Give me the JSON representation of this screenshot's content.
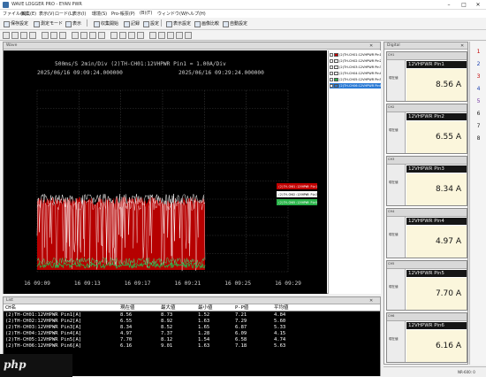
{
  "window": {
    "title": "WAVE LOGGER PRO - EYAN PWR"
  },
  "menu": [
    "ファイル(F)",
    "編集(E)",
    "表示(V)",
    "ロード(L)",
    "表示(I)",
    "環境(S)",
    "Pro-帳票(P)",
    "(B)(T)",
    "ウィンドウ(W)",
    "ヘルプ(H)"
  ],
  "toolbar": {
    "left": [
      "保存設定",
      "測定モード",
      "表示"
    ],
    "mid": [
      "収集開始",
      "記録",
      "設定"
    ],
    "right": [
      "表示設定",
      "画像比較",
      "自動設定"
    ]
  },
  "wave_panel": {
    "title": "Wave"
  },
  "chart": {
    "header_line": "500ms/S    2min/Div    (2)TH-CH01:12VHPWR Pin1 = 1.00A/Div",
    "start_time": "2025/06/16 09:09:24.000000",
    "end_time": "2025/06/16 09:29:24.000000",
    "x_ticks": [
      "16 09:09",
      "16 09:13",
      "16 09:17",
      "16 09:21",
      "16 09:25",
      "16 09:29"
    ],
    "colors": {
      "bg": "#000000",
      "grid": "#3a3a3a",
      "text": "#cfcfcf",
      "red": "#c00000",
      "green": "#2ab34a",
      "white": "#ffffff"
    },
    "series": [
      {
        "name": "(2)TH-CH01:12VHPWR Pin1",
        "color": "#c00000"
      },
      {
        "name": "(2)TH-CH02:12VHPWR Pin2",
        "color": "#f5f5f5"
      },
      {
        "name": "(2)TH-CH03:12VHPWR Pin3",
        "color": "#f5f5f5"
      },
      {
        "name": "(2)TH-CH04:12VHPWR Pin4",
        "color": "#f5f5f5"
      },
      {
        "name": "(2)TH-CH05:12VHPWR Pin5",
        "color": "#2ab34a"
      },
      {
        "name": "(2)TH-CH06:12VHPWR Pin6",
        "color": "#2a7ad5"
      }
    ]
  },
  "list_panel": {
    "title": "List"
  },
  "table": {
    "headers": [
      "CH名",
      "現在値",
      "最大値",
      "最小値",
      "P-P値",
      "平均値"
    ],
    "rows": [
      [
        "(2)TH-CH01:12VHPWR Pin1[A]",
        "8.56",
        "8.73",
        "1.52",
        "7.21",
        "4.84"
      ],
      [
        "(2)TH-CH02:12VHPWR Pin2[A]",
        "6.55",
        "8.92",
        "1.63",
        "7.29",
        "5.60"
      ],
      [
        "(2)TH-CH03:12VHPWR Pin3[A]",
        "8.34",
        "8.52",
        "1.65",
        "6.87",
        "5.33"
      ],
      [
        "(2)TH-CH04:12VHPWR Pin4[A]",
        "4.97",
        "7.37",
        "1.28",
        "6.09",
        "4.15"
      ],
      [
        "(2)TH-CH05:12VHPWR Pin5[A]",
        "7.70",
        "8.12",
        "1.54",
        "6.58",
        "4.74"
      ],
      [
        "(2)TH-CH06:12VHPWR Pin6[A]",
        "6.16",
        "9.01",
        "1.63",
        "7.18",
        "5.63"
      ]
    ]
  },
  "meter_panel": {
    "title": "Digital"
  },
  "meters": [
    {
      "ch": "CH1",
      "side": "現在値",
      "name": "12VHPWR Pin1",
      "value": "8.56 A"
    },
    {
      "ch": "CH2",
      "side": "現在値",
      "name": "12VHPWR Pin2",
      "value": "6.55 A"
    },
    {
      "ch": "CH3",
      "side": "現在値",
      "name": "12VHPWR Pin3",
      "value": "8.34 A"
    },
    {
      "ch": "CH4",
      "side": "現在値",
      "name": "12VHPWR Pin4",
      "value": "4.97 A"
    },
    {
      "ch": "CH5",
      "side": "現在値",
      "name": "12VHPWR Pin5",
      "value": "7.70 A"
    },
    {
      "ch": "CH6",
      "side": "現在値",
      "name": "12VHPWR Pin6",
      "value": "6.16 A"
    }
  ],
  "right_tools": [
    "1",
    "2",
    "3",
    "4",
    "5",
    "6",
    "7",
    "8"
  ],
  "statusbar": {
    "text": "NR-600: 0"
  },
  "watermark": {
    "text": "php"
  }
}
